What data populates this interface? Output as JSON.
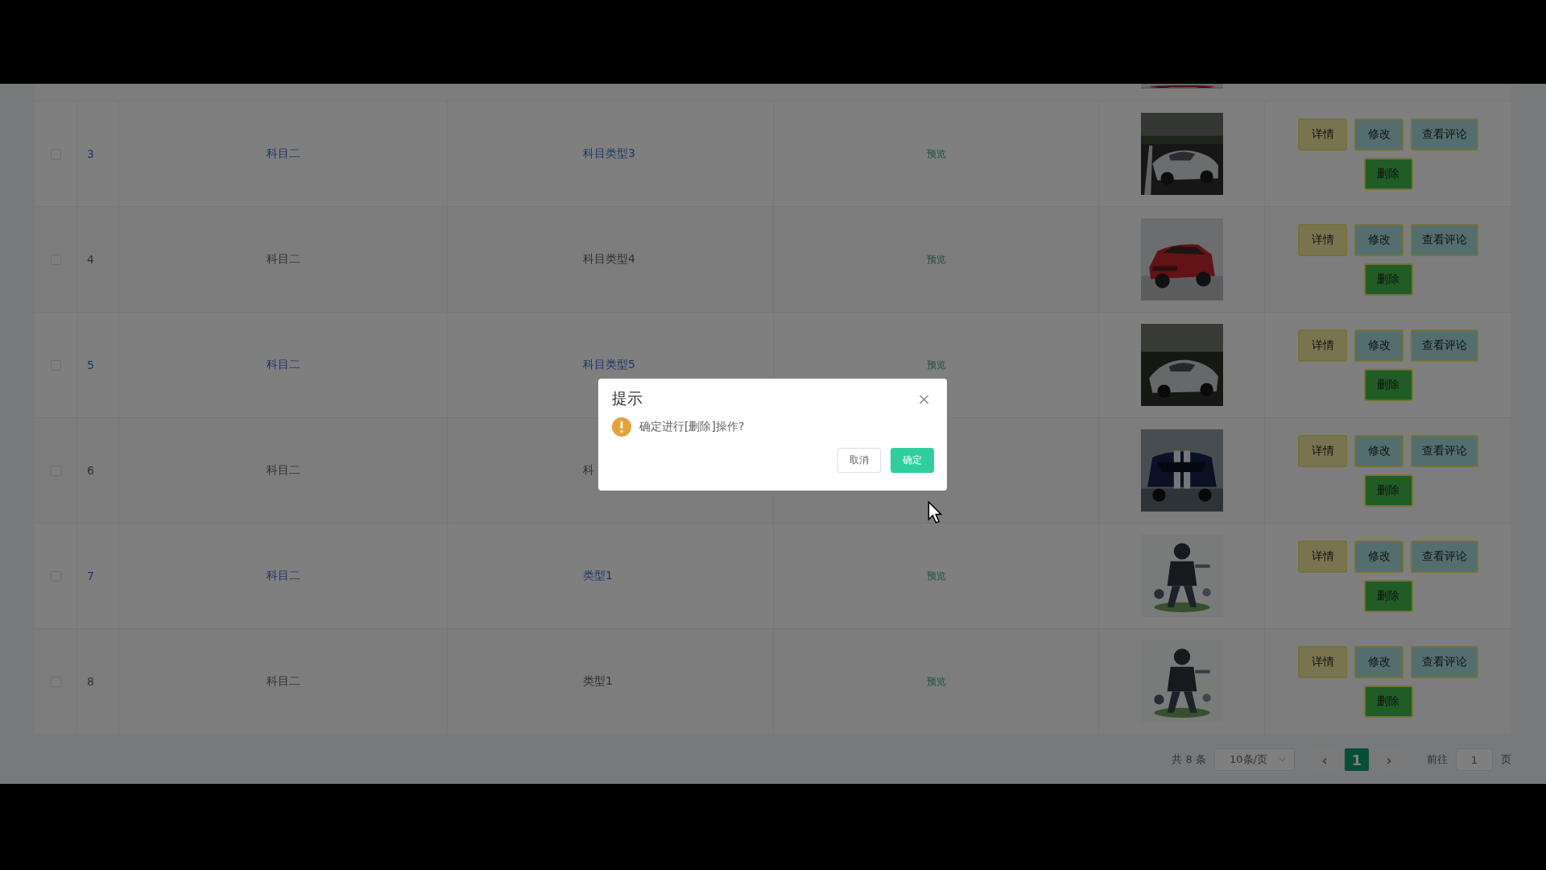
{
  "table": {
    "rows": [
      {
        "index": "3",
        "subject": "科目二",
        "type": "科目类型3",
        "preview": "预览",
        "highlighted": true,
        "checked": false,
        "actions": [
          {
            "label": "详情",
            "kind": "detail"
          },
          {
            "label": "修改",
            "kind": "edit"
          },
          {
            "label": "查看评论",
            "kind": "comments"
          },
          {
            "label": "删除",
            "kind": "delete"
          }
        ]
      },
      {
        "index": "4",
        "subject": "科目二",
        "type": "科目类型4",
        "preview": "预览",
        "highlighted": false,
        "checked": false,
        "actions": [
          {
            "label": "详情",
            "kind": "detail"
          },
          {
            "label": "修改",
            "kind": "edit"
          },
          {
            "label": "查看评论",
            "kind": "comments"
          },
          {
            "label": "删除",
            "kind": "delete"
          }
        ]
      },
      {
        "index": "5",
        "subject": "科目二",
        "type": "科目类型5",
        "preview": "预览",
        "highlighted": true,
        "checked": false,
        "actions": [
          {
            "label": "详情",
            "kind": "detail"
          },
          {
            "label": "修改",
            "kind": "edit"
          },
          {
            "label": "查看评论",
            "kind": "comments"
          },
          {
            "label": "删除",
            "kind": "delete"
          }
        ]
      },
      {
        "index": "6",
        "subject": "科目二",
        "type": "科",
        "highlighted": false,
        "checked": false,
        "actions": [
          {
            "label": "详情",
            "kind": "detail"
          },
          {
            "label": "修改",
            "kind": "edit"
          },
          {
            "label": "查看评论",
            "kind": "comments"
          },
          {
            "label": "删除",
            "kind": "delete"
          }
        ]
      },
      {
        "index": "7",
        "subject": "科目二",
        "type": "类型1",
        "preview": "预览",
        "highlighted": true,
        "checked": false,
        "actions": [
          {
            "label": "详情",
            "kind": "detail"
          },
          {
            "label": "修改",
            "kind": "edit"
          },
          {
            "label": "查看评论",
            "kind": "comments"
          },
          {
            "label": "删除",
            "kind": "delete"
          }
        ]
      },
      {
        "index": "8",
        "subject": "科目二",
        "type": "类型1",
        "preview": "预览",
        "highlighted": false,
        "checked": false,
        "actions": [
          {
            "label": "详情",
            "kind": "detail"
          },
          {
            "label": "修改",
            "kind": "edit"
          },
          {
            "label": "查看评论",
            "kind": "comments"
          },
          {
            "label": "删除",
            "kind": "delete"
          }
        ]
      }
    ]
  },
  "pagination": {
    "total": "共 8 条",
    "page_size": "10条/页",
    "prev": "‹",
    "pages": [
      {
        "label": "1",
        "selected": true
      }
    ],
    "next": "›",
    "goto_label": "前往",
    "goto_value": "1",
    "page_unit": "页"
  },
  "dialog": {
    "title": "提示",
    "close": "×",
    "message": "确定进行[删除]操作?",
    "buttons": [
      {
        "label": "取消",
        "kind": "cancel"
      },
      {
        "label": "确定",
        "kind": "confirm"
      }
    ]
  }
}
